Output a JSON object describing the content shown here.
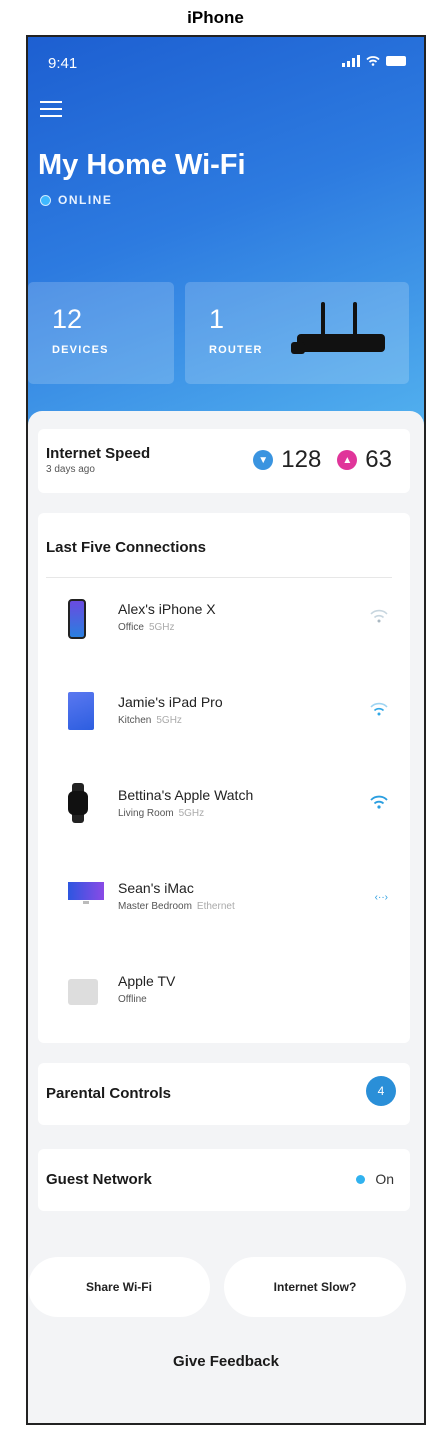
{
  "device_label": "iPhone",
  "status_bar": {
    "time": "9:41"
  },
  "header": {
    "title": "My Home Wi-Fi",
    "status": "ONLINE"
  },
  "stats": {
    "devices": {
      "count": "12",
      "label": "DEVICES"
    },
    "router": {
      "count": "1",
      "label": "ROUTER"
    }
  },
  "internet_speed": {
    "title": "Internet Speed",
    "subtitle": "3 days ago",
    "download": "128",
    "upload": "63"
  },
  "connections": {
    "title": "Last Five Connections",
    "items": [
      {
        "name": "Alex's iPhone X",
        "location": "Office",
        "band": "5GHz",
        "signal": "wifi-weak-icon"
      },
      {
        "name": "Jamie's iPad Pro",
        "location": "Kitchen",
        "band": "5GHz",
        "signal": "wifi-medium-icon"
      },
      {
        "name": "Bettina's Apple Watch",
        "location": "Living Room",
        "band": "5GHz",
        "signal": "wifi-strong-icon"
      },
      {
        "name": "Sean's iMac",
        "location": "Master Bedroom",
        "band": "Ethernet",
        "signal": "ethernet-icon"
      },
      {
        "name": "Apple TV",
        "location": "Offline",
        "band": "",
        "signal": ""
      }
    ]
  },
  "parental_controls": {
    "title": "Parental Controls",
    "count": "4"
  },
  "guest_network": {
    "title": "Guest Network",
    "state": "On"
  },
  "actions": {
    "share": "Share Wi-Fi",
    "slow": "Internet Slow?"
  },
  "feedback": "Give Feedback",
  "colors": {
    "accent": "#2a8fd8",
    "download": "#3a94e0",
    "upload": "#e0359a",
    "hero_start": "#1d5fd1",
    "hero_end": "#53b2ef"
  }
}
